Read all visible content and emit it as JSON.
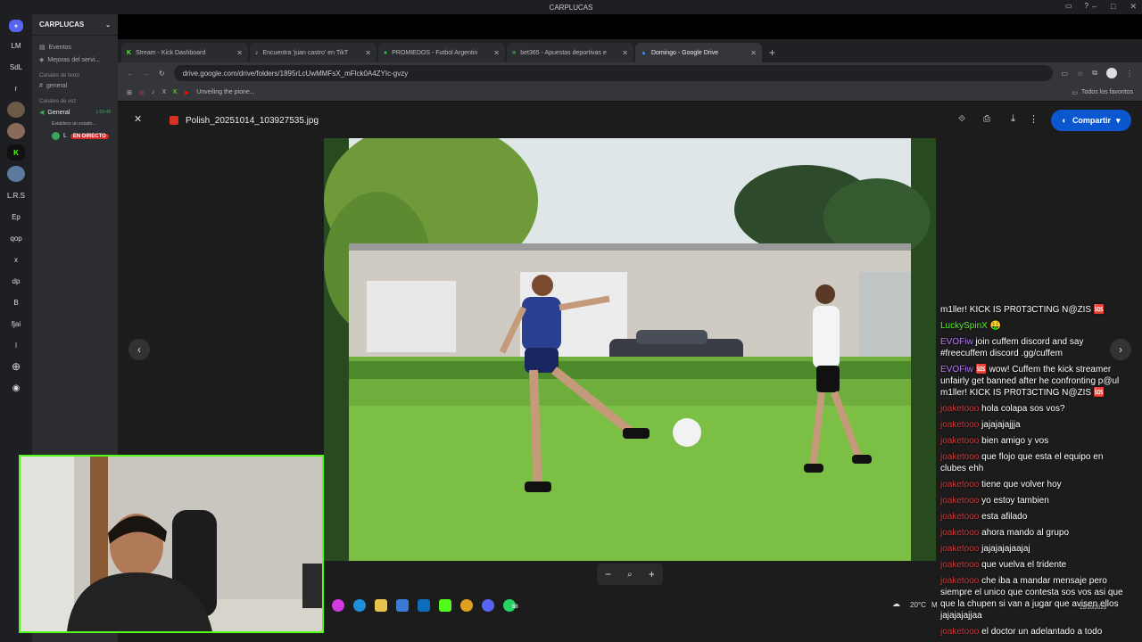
{
  "window": {
    "title": "CARPLUCAS",
    "controls": [
      "–",
      "□",
      "✕"
    ]
  },
  "rail": {
    "items": [
      "LM",
      "SdL",
      "r",
      "L.R.S",
      "Ep",
      "qop",
      "x",
      "dp",
      "B",
      "fjai",
      "l"
    ]
  },
  "channels": {
    "server_name": "CARPLUCAS",
    "events": "Eventos",
    "improvements": "Mejoras del servi...",
    "text_category": "Canales de texto",
    "text_channel": "general",
    "voice_category": "Canales de voz",
    "voice_channel": "General",
    "voice_time": "1:09:48",
    "voice_status": "Establece un estado...",
    "voice_user": "L",
    "live_badge": "EN DIRECTO"
  },
  "browser": {
    "tabs": [
      {
        "label": "Stream - Kick Dashboard",
        "color": "#53fc18"
      },
      {
        "label": "Encuentra 'juan castro' en TikT",
        "color": "#ffffff"
      },
      {
        "label": "PROMIEDOS - Futbol Argentin",
        "color": "#2ecc40"
      },
      {
        "label": "bet365 - Apuestas deportivas e",
        "color": "#2b8a3e"
      },
      {
        "label": "Domingo - Google Drive",
        "color": "#4285f4"
      }
    ],
    "url": "drive.google.com/drive/folders/1895rLcUwMMFsX_mFlck0A4ZYIc-gvzy",
    "bookmark_text": "Unveiling the pione...",
    "favorites": "Todos los favoritos"
  },
  "viewer": {
    "file_name": "Polish_20251014_103927535.jpg",
    "share_label": "Compartir",
    "zoom_minus": "−",
    "zoom_plus": "+"
  },
  "taskbar": {
    "weather": "20°C",
    "weather_short": "M",
    "date": "15/10/2025",
    "whatsapp_badge": "68"
  },
  "chat": {
    "messages": [
      {
        "user": "",
        "text": "m1ller! KICK IS PR0T3CTING N@ZIS 🆘",
        "ucolor": ""
      },
      {
        "user": "LuckySpinX",
        "text": "🤑",
        "ucolor": "#53fc18"
      },
      {
        "user": "EVOFiw",
        "text": "join cuffem discord and say #freecuffem discord .gg/cuffem",
        "ucolor": "#b57af5"
      },
      {
        "user": "EVOFiw",
        "text": "🆘 wow! Cuffem the kick streamer unfairly get banned after he confronting p@ul m1ller! KICK IS PR0T3CTING N@ZIS 🆘",
        "ucolor": "#b57af5"
      },
      {
        "user": "joaketooo",
        "text": "hola colapa sos vos?",
        "ucolor": "#d23a3a"
      },
      {
        "user": "joaketooo",
        "text": "jajajajajjja",
        "ucolor": "#d23a3a"
      },
      {
        "user": "joaketooo",
        "text": "bien amigo y vos",
        "ucolor": "#d23a3a"
      },
      {
        "user": "joaketooo",
        "text": "que flojo que esta el equipo en clubes ehh",
        "ucolor": "#d23a3a"
      },
      {
        "user": "joaketooo",
        "text": "tiene que volver hoy",
        "ucolor": "#d23a3a"
      },
      {
        "user": "joaketooo",
        "text": "yo estoy tambien",
        "ucolor": "#d23a3a"
      },
      {
        "user": "joaketooo",
        "text": "esta afilado",
        "ucolor": "#d23a3a"
      },
      {
        "user": "joaketooo",
        "text": "ahora mando al grupo",
        "ucolor": "#d23a3a"
      },
      {
        "user": "joaketooo",
        "text": "jajajajajaajaj",
        "ucolor": "#d23a3a"
      },
      {
        "user": "joaketooo",
        "text": "que vuelva el tridente",
        "ucolor": "#d23a3a"
      },
      {
        "user": "joaketooo",
        "text": "che iba a mandar mensaje pero siempre el unico que contesta sos vos asi que que la chupen si van a jugar que avisen ellos jajajajajjaa",
        "ucolor": "#d23a3a"
      },
      {
        "user": "joaketooo",
        "text": "el doctor un adelantado a todo",
        "ucolor": "#d23a3a"
      }
    ]
  }
}
